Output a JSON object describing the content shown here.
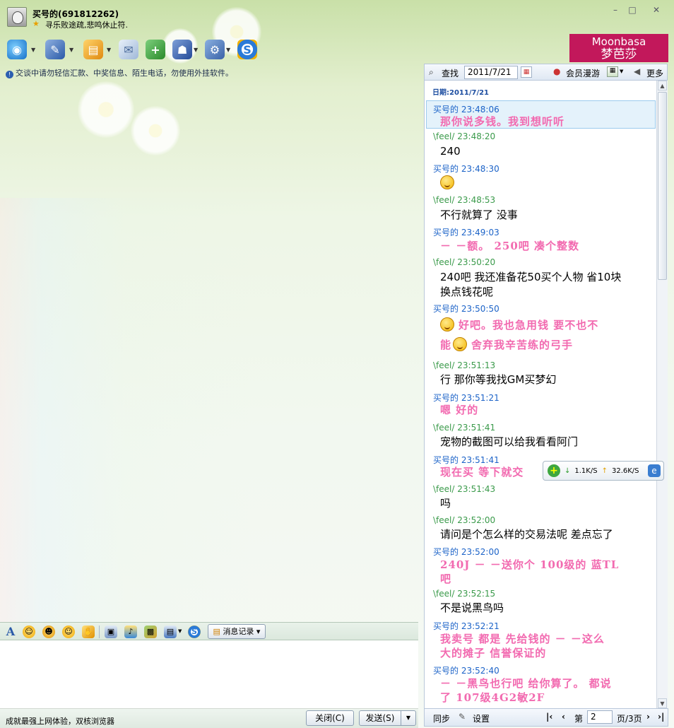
{
  "window": {
    "name": "买号的(691812262)",
    "signature": "寻乐败途疏,悲鸣休止符.",
    "controls": {
      "minimize": "–",
      "maximize": "□",
      "close": "✕"
    }
  },
  "toolbar": {
    "icons": [
      "video-call-icon",
      "voice-call-icon",
      "send-file-icon",
      "send-mail-icon",
      "create-group-icon",
      "remote-assist-icon",
      "app-settings-icon",
      "soso-icon"
    ]
  },
  "ad": {
    "line1": "Moonbasa",
    "line2": "梦芭莎"
  },
  "warning": "交谈中请勿轻信汇款、中奖信息、陌生电话，勿使用外挂软件。",
  "history_toolbar": {
    "search_label": "查找",
    "date_value": "2011/7/21",
    "member_roam_label": "会员漫游",
    "more_label": "更多"
  },
  "history": {
    "date_header": "日期:2011/7/21",
    "messages": [
      {
        "sender": "买号的",
        "time": "23:48:06",
        "text": "那你说多钱。我到想听听",
        "mine": true
      },
      {
        "sender": "\\feel/",
        "time": "23:48:20",
        "text": "240",
        "mine": false
      },
      {
        "sender": "买号的",
        "time": "23:48:30",
        "text": "",
        "mine": true,
        "emoticon": "grin-face"
      },
      {
        "sender": "\\feel/",
        "time": "23:48:53",
        "text": "不行就算了 没事",
        "mine": false
      },
      {
        "sender": "买号的",
        "time": "23:49:03",
        "text": "－ －额。 250吧 凑个整数",
        "mine": true
      },
      {
        "sender": "\\feel/",
        "time": "23:50:20",
        "text_line1": "240吧  我还准备花50买个人物 省10块",
        "text_line2": "换点钱花呢",
        "mine": false
      },
      {
        "sender": "买号的",
        "time": "23:50:50",
        "text_line1": "好吧。我也急用钱  要不也不",
        "text_line2_a": "能",
        "text_line2_b": "舍弃我辛苦练的弓手",
        "mine": true
      },
      {
        "sender": "\\feel/",
        "time": "23:51:13",
        "text": "行 那你等我找GM买梦幻",
        "mine": false
      },
      {
        "sender": "买号的",
        "time": "23:51:21",
        "text": "嗯  好的",
        "mine": true
      },
      {
        "sender": "\\feel/",
        "time": "23:51:41",
        "text": "宠物的截图可以给我看看阿门",
        "mine": false
      },
      {
        "sender": "买号的",
        "time": "23:51:41",
        "text": "现在买  等下就交",
        "mine": true
      },
      {
        "sender": "\\feel/",
        "time": "23:51:43",
        "text": "吗",
        "mine": false
      },
      {
        "sender": "\\feel/",
        "time": "23:52:00",
        "text": "请问是个怎么样的交易法呢  差点忘了",
        "mine": false
      },
      {
        "sender": "买号的",
        "time": "23:52:00",
        "text_line1": "240J － －送你个  100级的  蓝TL",
        "text_line2": "吧",
        "mine": true
      },
      {
        "sender": "\\feel/",
        "time": "23:52:15",
        "text": "不是说黑鸟吗",
        "mine": false
      },
      {
        "sender": "买号的",
        "time": "23:52:21",
        "text_line1": "我卖号  都是  先给钱的 － －这么",
        "text_line2": "大的摊子  信誉保证的",
        "mine": true
      },
      {
        "sender": "买号的",
        "time": "23:52:40",
        "text_line1": "－ －黑鸟也行吧  给你算了。  都说",
        "text_line2": "了  107级4G2敏2F",
        "mine": true
      }
    ]
  },
  "speed_widget": {
    "download": "1.1K/S",
    "upload": "32.6K/S"
  },
  "input_toolbar": {
    "icons": [
      "font-icon",
      "emoticon-icon",
      "magic-emoticon-icon",
      "wink-icon",
      "shake-icon",
      "screenshot-icon",
      "music-icon",
      "gift-icon",
      "image-icon",
      "soso-icon"
    ],
    "history_button": "消息记录"
  },
  "status_bar": {
    "text": "成就最强上网体验，双核浏览器"
  },
  "buttons": {
    "close": "关闭(C)",
    "send": "发送(S)"
  },
  "history_footer": {
    "sync_label": "同步",
    "settings_label": "设置",
    "page_prefix": "第",
    "page_value": "2",
    "page_suffix": "页/3页"
  }
}
